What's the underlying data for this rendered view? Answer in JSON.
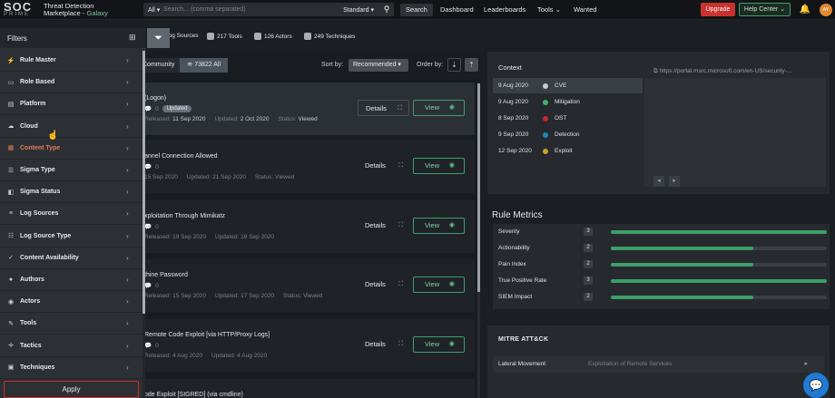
{
  "header": {
    "logo_line1": "SOC",
    "logo_line2": "PRIME",
    "brand_line1": "Threat Detection",
    "brand_line2a": "Marketplace - ",
    "brand_line2b": "Galaxy",
    "search": {
      "scope": "All",
      "placeholder": "Search... (comma separated)",
      "mode": "Standard"
    },
    "nav": [
      "Search",
      "Dashboard",
      "Leaderboards",
      "Tools",
      "Wanted"
    ],
    "upgrade": "Upgrade",
    "help_center": "Help Center",
    "avatar": "AY"
  },
  "stats": {
    "log_sources": "Log Sources",
    "tools": "217 Tools",
    "actors": "126 Actors",
    "techniques": "249 Techniques"
  },
  "list": {
    "tab_community": "Community",
    "tab_all": "73822 All",
    "sort_label": "Sort by:",
    "sort_value": "Recommended",
    "order_label": "Order by:",
    "details_label": "Details",
    "view_label": "View",
    "cards": [
      {
        "title": "(Logon)",
        "badge": "Updated",
        "count": "0",
        "released_label": "Released:",
        "released": "11 Sep 2020",
        "updated_label": "Updated:",
        "updated": "2 Oct 2020",
        "status_label": "Status:",
        "status": "Viewed"
      },
      {
        "title": "annel Connection Allowed",
        "count": "0",
        "released_label": "",
        "released": "15 Sep 2020",
        "updated_label": "Updated:",
        "updated": "21 Sep 2020",
        "status_label": "Status:",
        "status": "Viewed"
      },
      {
        "title": "xploitation Through Mimikatz",
        "count": "0",
        "released_label": "Released:",
        "released": "19 Sep 2020",
        "updated_label": "Updated:",
        "updated": "19 Sep 2020",
        "status_label": "",
        "status": ""
      },
      {
        "title": "thine Password",
        "count": "0",
        "released_label": "Released:",
        "released": "15 Sep 2020",
        "updated_label": "Updated:",
        "updated": "17 Sep 2020",
        "status_label": "Status:",
        "status": "Viewed"
      },
      {
        "title": "Remote Code Exploit [via HTTP/Proxy Logs]",
        "count": "0",
        "released_label": "Released:",
        "released": "4 Aug 2020",
        "updated_label": "Updated:",
        "updated": "4 Aug 2020",
        "status_label": "",
        "status": ""
      },
      {
        "title": "ode Exploit [SIGRED] (via cmdline)"
      }
    ]
  },
  "context": {
    "title": "Context",
    "link": "https://portal.msrc.microsoft.com/en-US/security-...",
    "rows": [
      {
        "date": "9 Aug 2020",
        "label": "CVE",
        "color": "#c9cdd1"
      },
      {
        "date": "9 Aug 2020",
        "label": "Mitigation",
        "color": "#3fb36a"
      },
      {
        "date": "8 Sep 2020",
        "label": "OST",
        "color": "#c62828"
      },
      {
        "date": "9 Sep 2020",
        "label": "Detection",
        "color": "#1e88b5"
      },
      {
        "date": "12 Sep 2020",
        "label": "Exploit",
        "color": "#c9a227"
      }
    ]
  },
  "metrics": {
    "title": "Rule Metrics",
    "items": [
      {
        "label": "Severity",
        "value": "3",
        "fill": 1.0
      },
      {
        "label": "Actionability",
        "value": "2",
        "fill": 0.66
      },
      {
        "label": "Pain Index",
        "value": "2",
        "fill": 0.66
      },
      {
        "label": "True Positive Rate",
        "value": "3",
        "fill": 1.0
      },
      {
        "label": "SIEM Impact",
        "value": "2",
        "fill": 0.66
      }
    ]
  },
  "mitre": {
    "title": "MITRE ATT&CK",
    "tactic": "Lateral Movement",
    "technique": "Exploitation of Remote Services"
  },
  "filters": {
    "title": "Filters",
    "apply": "Apply",
    "items": [
      {
        "label": "Rule Master",
        "icon": "bolt-icon",
        "glyph": "⚡"
      },
      {
        "label": "Role Based",
        "icon": "id-card-icon",
        "glyph": "▭"
      },
      {
        "label": "Platform",
        "icon": "platform-icon",
        "glyph": "▤"
      },
      {
        "label": "Cloud",
        "icon": "cloud-icon",
        "glyph": "☁"
      },
      {
        "label": "Content Type",
        "icon": "content-type-icon",
        "glyph": "▦",
        "active": true
      },
      {
        "label": "Sigma Type",
        "icon": "sigma-type-icon",
        "glyph": "☰"
      },
      {
        "label": "Sigma Status",
        "icon": "status-icon",
        "glyph": "◧"
      },
      {
        "label": "Log Sources",
        "icon": "database-icon",
        "glyph": "≡"
      },
      {
        "label": "Log Source Type",
        "icon": "log-source-type-icon",
        "glyph": "☷"
      },
      {
        "label": "Content Availability",
        "icon": "check-icon",
        "glyph": "✓"
      },
      {
        "label": "Authors",
        "icon": "user-icon",
        "glyph": "●"
      },
      {
        "label": "Actors",
        "icon": "actor-icon",
        "glyph": "◉"
      },
      {
        "label": "Tools",
        "icon": "wrench-icon",
        "glyph": "✎"
      },
      {
        "label": "Tactics",
        "icon": "crosshair-icon",
        "glyph": "✛"
      },
      {
        "label": "Techniques",
        "icon": "technique-icon",
        "glyph": "▣"
      }
    ]
  }
}
